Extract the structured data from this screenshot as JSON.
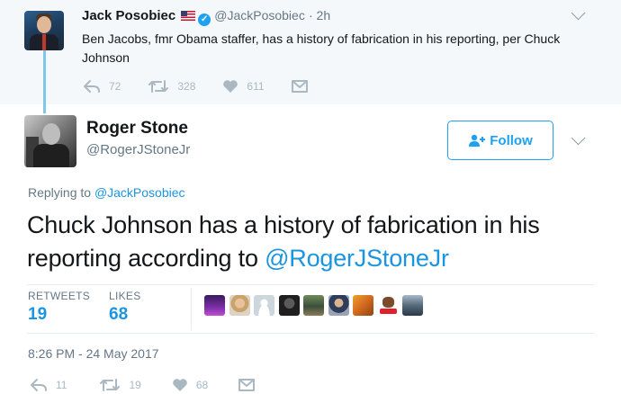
{
  "parent_tweet": {
    "name": "Jack Posobiec",
    "handle": "@JackPosobiec",
    "time": "· 2h",
    "text": "Ben Jacobs, fmr Obama staffer, has a history of fabrication in his reporting, per Chuck Johnson",
    "replies": "72",
    "retweets": "328",
    "likes": "611"
  },
  "main_tweet": {
    "name": "Roger Stone",
    "handle": "@RogerJStoneJr",
    "follow_label": "Follow",
    "replying_prefix": "Replying to",
    "replying_handle": "@JackPosobiec",
    "text_before_link": "Chuck Johnson has a history of fabrication in his reporting according to ",
    "text_link": "@RogerJStoneJr",
    "retweets_label": "RETWEETS",
    "retweets_count": "19",
    "likes_label": "LIKES",
    "likes_count": "68",
    "liker_avatars": [
      "purple-stage",
      "blonde-woman",
      "default-silhouette",
      "dark-man",
      "green-group",
      "man-portrait",
      "orange-art",
      "mack-logo",
      "group-photo"
    ],
    "timestamp": "8:26 PM - 24 May 2017",
    "action_replies": "11",
    "action_retweets": "19",
    "action_likes": "68"
  },
  "icons": [
    "reply-icon",
    "retweet-icon",
    "heart-icon",
    "message-icon",
    "verified-icon",
    "flag-icon",
    "chevron-down-icon",
    "add-person-icon"
  ],
  "colors": {
    "accent": "#1da1f2",
    "link": "#1b95e0",
    "muted": "#657786",
    "action": "#aab8c2",
    "parent_bg": "#f5f8fa"
  }
}
